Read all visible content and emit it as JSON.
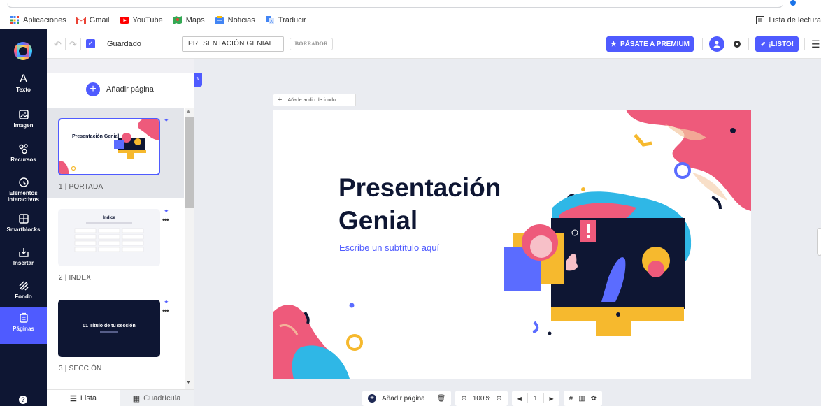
{
  "bookmarks": {
    "items": [
      {
        "label": "Aplicaciones",
        "icon": "apps-grid-icon",
        "color": "#4285f4"
      },
      {
        "label": "Gmail",
        "icon": "gmail-icon",
        "color": "#ea4335"
      },
      {
        "label": "YouTube",
        "icon": "youtube-icon",
        "color": "#ff0000"
      },
      {
        "label": "Maps",
        "icon": "maps-icon",
        "color": "#34a853"
      },
      {
        "label": "Noticias",
        "icon": "news-icon",
        "color": "#4285f4"
      },
      {
        "label": "Traducir",
        "icon": "translate-icon",
        "color": "#4285f4"
      }
    ],
    "reading_list": "Lista de lectura"
  },
  "sidebar": {
    "items": [
      {
        "label": "Texto",
        "icon": "text-icon"
      },
      {
        "label": "Imagen",
        "icon": "image-icon"
      },
      {
        "label": "Recursos",
        "icon": "resources-icon"
      },
      {
        "label": "Elementos interactivos",
        "icon": "interactive-icon"
      },
      {
        "label": "Smartblocks",
        "icon": "smartblocks-icon"
      },
      {
        "label": "Insertar",
        "icon": "insert-icon"
      },
      {
        "label": "Fondo",
        "icon": "background-icon"
      },
      {
        "label": "Páginas",
        "icon": "pages-icon"
      }
    ],
    "active": "Páginas"
  },
  "toolbar": {
    "saved_label": "Guardado",
    "title_value": "PRESENTACIÓN GENIAL",
    "draft_label": "BORRADOR",
    "premium_label": "PÁSATE A PREMIUM",
    "ready_label": "¡LISTO!"
  },
  "panel": {
    "add_page_label": "Añadir página",
    "pages": [
      {
        "label": "1 | PORTADA",
        "thumb_title": "Presentación Genial"
      },
      {
        "label": "2 | INDEX",
        "thumb_title": "Índice"
      },
      {
        "label": "3 | SECCIÓN",
        "thumb_title": "01 Título de tu sección"
      }
    ],
    "tab_list": "Lista",
    "tab_grid": "Cuadrícula"
  },
  "canvas": {
    "audio_label": "Añade audio de fondo",
    "slide_title_line1": "Presentación",
    "slide_title_line2": "Genial",
    "slide_subtitle": "Escribe un subtítulo aquí"
  },
  "bottom": {
    "add_page_label": "Añadir página",
    "zoom": "100%",
    "page_number": "1"
  },
  "colors": {
    "accent": "#4f5bff",
    "sidebar_bg": "#0e1633",
    "title": "#0e1633",
    "pink": "#ee5a7b",
    "yellow": "#f6b92e",
    "cyan": "#2fb7e6"
  }
}
